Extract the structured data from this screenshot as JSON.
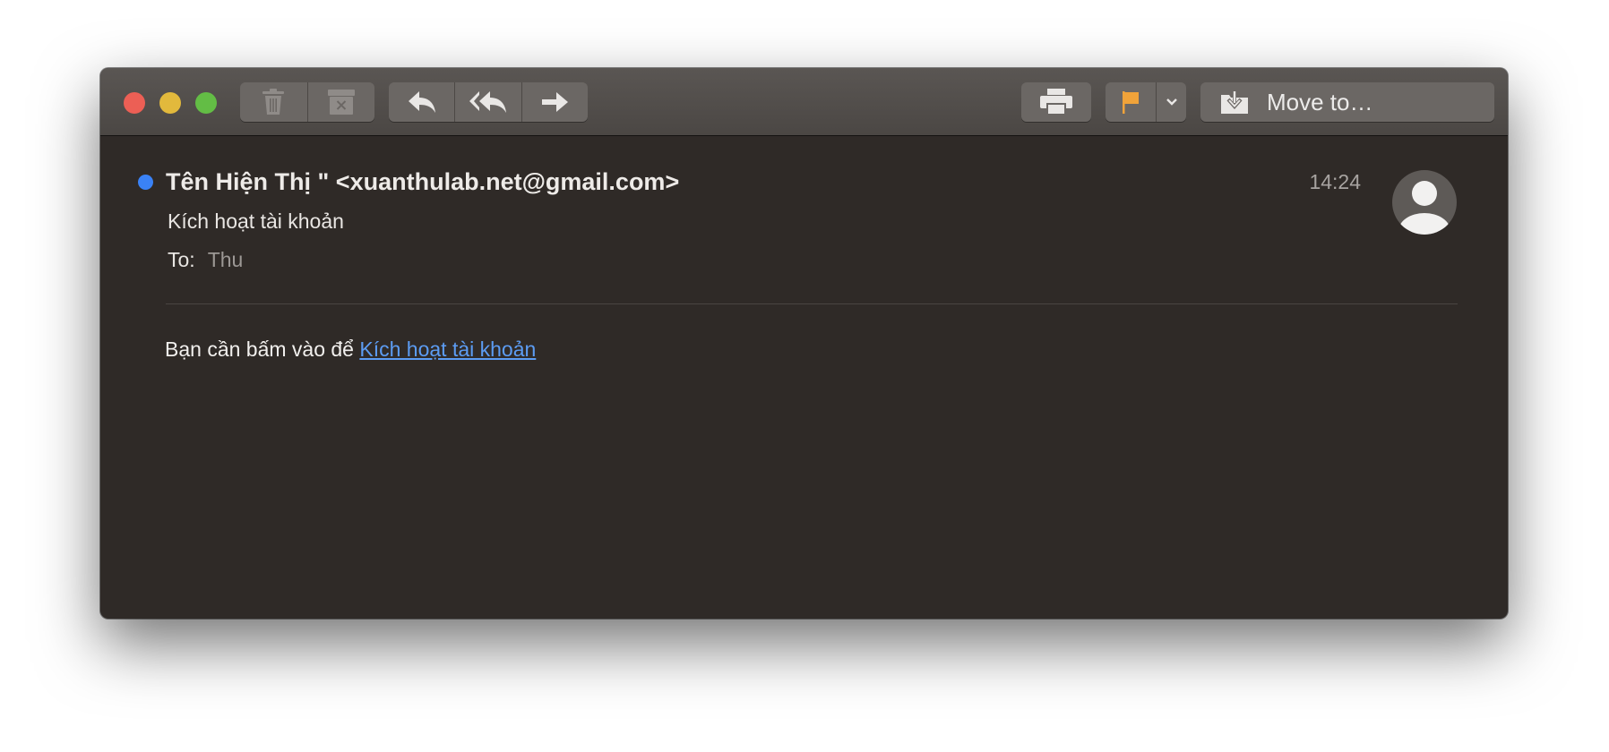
{
  "toolbar": {
    "move_to_label": "Move to…"
  },
  "message": {
    "sender": "Tên Hiện Thị \" <xuanthulab.net@gmail.com>",
    "subject": "Kích hoạt tài khoản",
    "to_label": "To:",
    "to_value": "Thu",
    "time": "14:24",
    "body_text": "Bạn cần bấm vào để ",
    "body_link": "Kích hoạt tài khoản"
  },
  "colors": {
    "unread_dot": "#3a82f6",
    "link": "#5c9cf3",
    "flag": "#f0a33a",
    "window_bg": "#2f2a27"
  },
  "icons": {
    "toolbar": [
      "trash-icon",
      "archive-icon",
      "reply-icon",
      "reply-all-icon",
      "forward-icon",
      "printer-icon",
      "flag-icon",
      "chevron-down-icon",
      "move-to-icon"
    ],
    "header": [
      "unread-dot-icon",
      "avatar-icon"
    ]
  }
}
